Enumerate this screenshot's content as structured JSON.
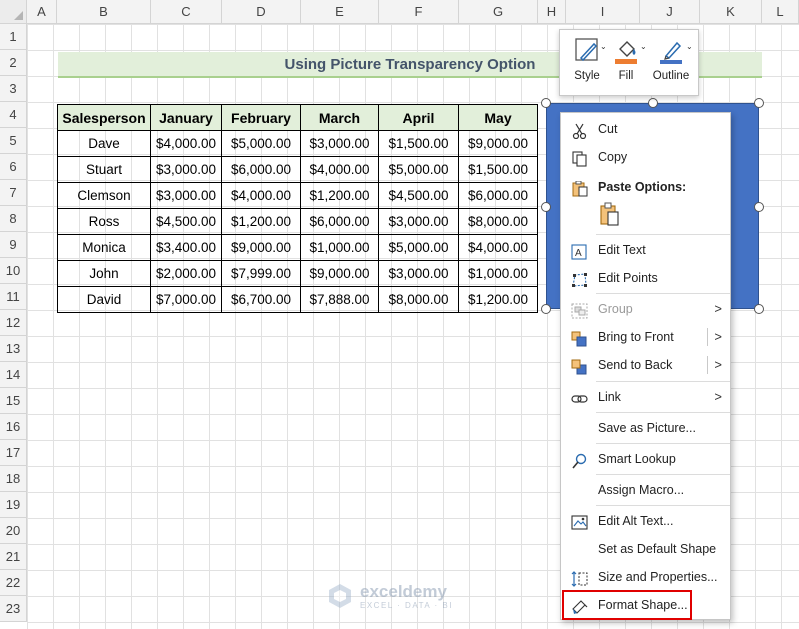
{
  "sheet": {
    "columns": [
      "A",
      "B",
      "C",
      "D",
      "E",
      "F",
      "G",
      "H",
      "I",
      "J",
      "K",
      "L"
    ],
    "rows": [
      "1",
      "2",
      "3",
      "4",
      "5",
      "6",
      "7",
      "8",
      "9",
      "10",
      "11",
      "12",
      "13",
      "14",
      "15",
      "16",
      "17",
      "18",
      "19",
      "20",
      "21",
      "22",
      "23"
    ]
  },
  "title": "Using Picture Transparency Option",
  "table": {
    "headers": [
      "Salesperson",
      "January",
      "February",
      "March",
      "April",
      "May"
    ],
    "rows": [
      [
        "Dave",
        "$4,000.00",
        "$5,000.00",
        "$3,000.00",
        "$1,500.00",
        "$9,000.00"
      ],
      [
        "Stuart",
        "$3,000.00",
        "$6,000.00",
        "$4,000.00",
        "$5,000.00",
        "$1,500.00"
      ],
      [
        "Clemson",
        "$3,000.00",
        "$4,000.00",
        "$1,200.00",
        "$4,500.00",
        "$6,000.00"
      ],
      [
        "Ross",
        "$4,500.00",
        "$1,200.00",
        "$6,000.00",
        "$3,000.00",
        "$8,000.00"
      ],
      [
        "Monica",
        "$3,400.00",
        "$9,000.00",
        "$1,000.00",
        "$5,000.00",
        "$4,000.00"
      ],
      [
        "John",
        "$2,000.00",
        "$7,999.00",
        "$9,000.00",
        "$3,000.00",
        "$1,000.00"
      ],
      [
        "David",
        "$7,000.00",
        "$6,700.00",
        "$7,888.00",
        "$8,000.00",
        "$1,200.00"
      ]
    ]
  },
  "mini_toolbar": {
    "style": "Style",
    "fill": "Fill",
    "outline": "Outline"
  },
  "context_menu": {
    "cut": "Cut",
    "copy": "Copy",
    "paste_options": "Paste Options:",
    "edit_text": "Edit Text",
    "edit_points": "Edit Points",
    "group": "Group",
    "bring_to_front": "Bring to Front",
    "send_to_back": "Send to Back",
    "link": "Link",
    "save_as_picture": "Save as Picture...",
    "smart_lookup": "Smart Lookup",
    "assign_macro": "Assign Macro...",
    "edit_alt_text": "Edit Alt Text...",
    "set_default_shape": "Set as Default Shape",
    "size_and_properties": "Size and Properties...",
    "format_shape": "Format Shape..."
  },
  "watermark": {
    "name": "exceldemy",
    "tagline": "EXCEL · DATA · BI"
  },
  "colors": {
    "shape_fill": "#4472c4",
    "header_fill": "#e2efda",
    "highlight": "#e00000",
    "fill_accent": "#ed7d31",
    "outline_accent": "#4472c4"
  }
}
